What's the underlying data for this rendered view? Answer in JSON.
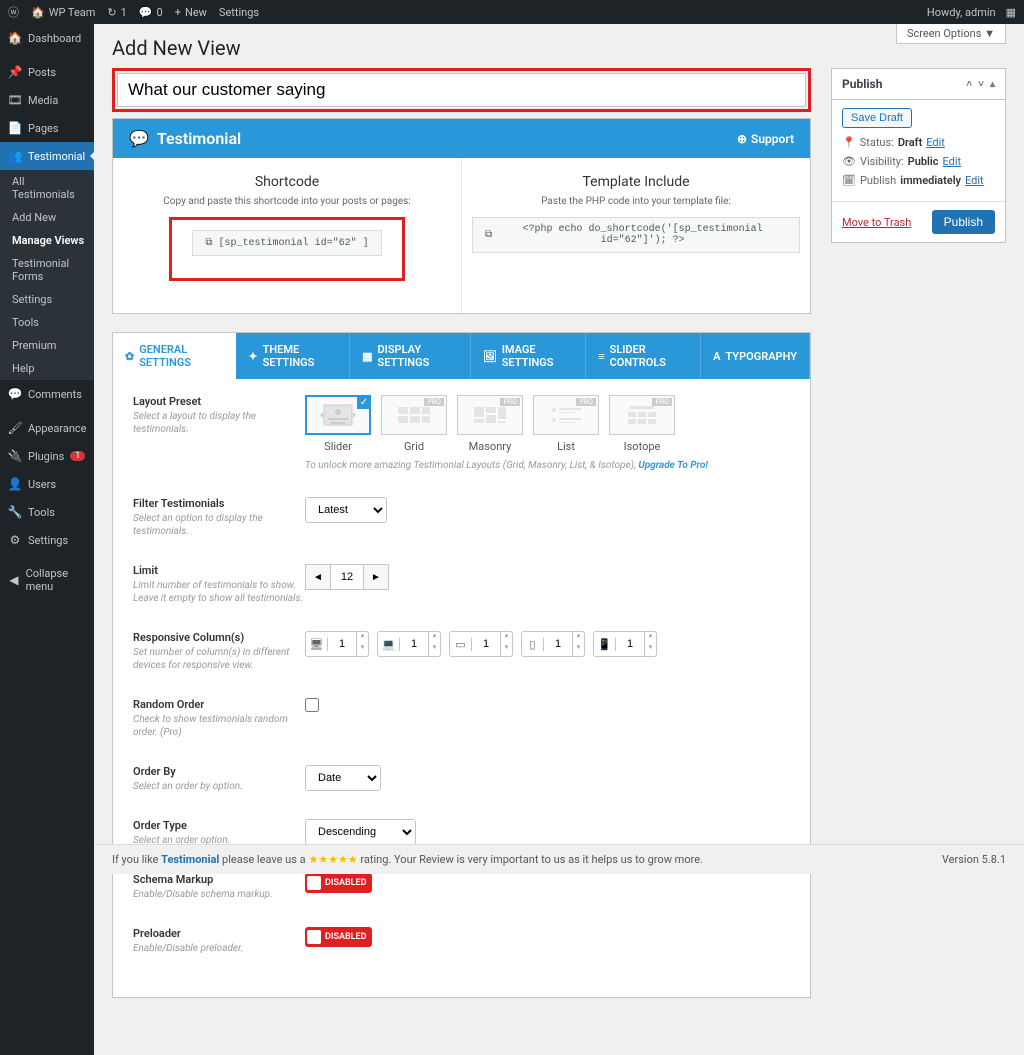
{
  "adminbar": {
    "site": "WP Team",
    "updates": "1",
    "comments": "0",
    "new": "New",
    "settings": "Settings",
    "howdy": "Howdy, admin"
  },
  "screen_options": "Screen Options ▼",
  "sidebar": {
    "items": [
      {
        "label": "Dashboard",
        "icon": "🏠"
      },
      {
        "label": "Posts",
        "icon": "📌"
      },
      {
        "label": "Media",
        "icon": "🖼"
      },
      {
        "label": "Pages",
        "icon": "📄"
      },
      {
        "label": "Testimonial",
        "icon": "👥",
        "active": true
      },
      {
        "label": "Comments",
        "icon": "💬"
      },
      {
        "label": "Appearance",
        "icon": "🎨"
      },
      {
        "label": "Plugins",
        "icon": "🔌",
        "badge": "1"
      },
      {
        "label": "Users",
        "icon": "👤"
      },
      {
        "label": "Tools",
        "icon": "🔧"
      },
      {
        "label": "Settings",
        "icon": "⚙"
      },
      {
        "label": "Collapse menu",
        "icon": "◀"
      }
    ],
    "submenu": [
      "All Testimonials",
      "Add New",
      "Manage Views",
      "Testimonial Forms",
      "Settings",
      "Tools",
      "Premium",
      "Help"
    ],
    "submenu_active": "Manage Views"
  },
  "page_title": "Add New View",
  "title_value": "What our customer saying",
  "panel": {
    "title": "Testimonial",
    "support": "Support",
    "shortcode": {
      "heading": "Shortcode",
      "desc": "Copy and paste this shortcode into your posts or pages:",
      "code": "[sp_testimonial id=\"62\" ]"
    },
    "template": {
      "heading": "Template Include",
      "desc": "Paste the PHP code into your template file:",
      "code": "<?php echo do_shortcode('[sp_testimonial id=\"62\"]'); ?>"
    }
  },
  "tabs": [
    "GENERAL SETTINGS",
    "THEME SETTINGS",
    "DISPLAY SETTINGS",
    "IMAGE SETTINGS",
    "SLIDER CONTROLS",
    "TYPOGRAPHY"
  ],
  "settings": {
    "layout_preset": {
      "label": "Layout Preset",
      "desc": "Select a layout to display the testimonials."
    },
    "layout_options": [
      "Slider",
      "Grid",
      "Masonry",
      "List",
      "Isotope"
    ],
    "upgrade_note_prefix": "To unlock more amazing Testimonial Layouts (Grid, Masonry, List, & Isotope), ",
    "upgrade_link": "Upgrade To Pro!",
    "filter": {
      "label": "Filter Testimonials",
      "desc": "Select an option to display the testimonials.",
      "value": "Latest"
    },
    "limit": {
      "label": "Limit",
      "desc": "Limit number of testimonials to show. Leave it empty to show all testimonials.",
      "value": "12"
    },
    "responsive": {
      "label": "Responsive Column(s)",
      "desc": "Set number of column(s) in different devices for responsive view.",
      "vals": [
        "1",
        "1",
        "1",
        "1",
        "1"
      ]
    },
    "random": {
      "label": "Random Order",
      "desc": "Check to show testimonials random order. (Pro)"
    },
    "orderby": {
      "label": "Order By",
      "desc": "Select an order by option.",
      "value": "Date"
    },
    "ordertype": {
      "label": "Order Type",
      "desc": "Select an order option.",
      "value": "Descending"
    },
    "schema": {
      "label": "Schema Markup",
      "desc": "Enable/Disable schema markup.",
      "value": "DISABLED"
    },
    "preloader": {
      "label": "Preloader",
      "desc": "Enable/Disable preloader.",
      "value": "DISABLED"
    }
  },
  "publish": {
    "heading": "Publish",
    "save_draft": "Save Draft",
    "status_label": "Status:",
    "status_value": "Draft",
    "visibility_label": "Visibility:",
    "visibility_value": "Public",
    "schedule_label": "Publish",
    "schedule_value": "immediately",
    "edit": "Edit",
    "trash": "Move to Trash",
    "publish_btn": "Publish"
  },
  "footer": {
    "left_prefix": "If you like ",
    "left_name": "Testimonial",
    "left_mid": " please leave us a ",
    "stars": "★★★★★",
    "left_suffix": " rating. Your Review is very important to us as it helps us to grow more.",
    "version": "Version 5.8.1"
  }
}
